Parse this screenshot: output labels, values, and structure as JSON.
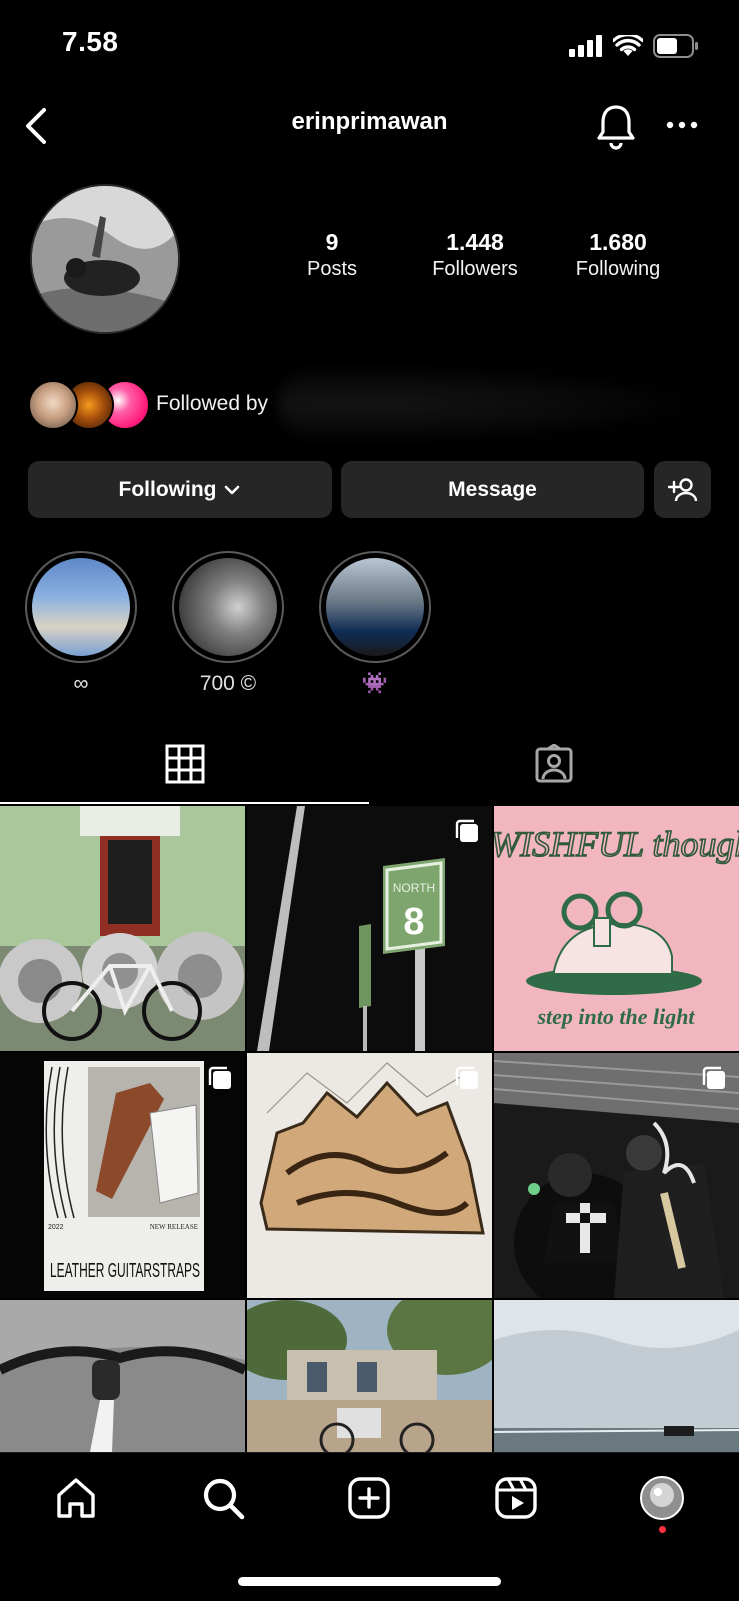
{
  "status_bar": {
    "time": "7.58"
  },
  "header": {
    "username": "erinprimawan"
  },
  "profile": {
    "stats": [
      {
        "value": "9",
        "label": "Posts"
      },
      {
        "value": "1.448",
        "label": "Followers"
      },
      {
        "value": "1.680",
        "label": "Following"
      }
    ],
    "followed_by_text": "Followed by"
  },
  "actions": {
    "following_label": "Following",
    "message_label": "Message"
  },
  "highlights": [
    {
      "label": "∞"
    },
    {
      "label": "700 ©"
    },
    {
      "label": "👾"
    }
  ],
  "posts": [
    {
      "art": "AWISHFUL thought",
      "caption": "step into the light"
    },
    {
      "art": "LEATHER GUITARSTRAPS",
      "year": "2022",
      "tag": "NEW RELEASE"
    },
    {
      "sign_text": "NORTH",
      "sign_number": "8"
    }
  ],
  "colors": {
    "notification_dot": "#ff3040",
    "accent_pink": "#ff2d8a"
  }
}
